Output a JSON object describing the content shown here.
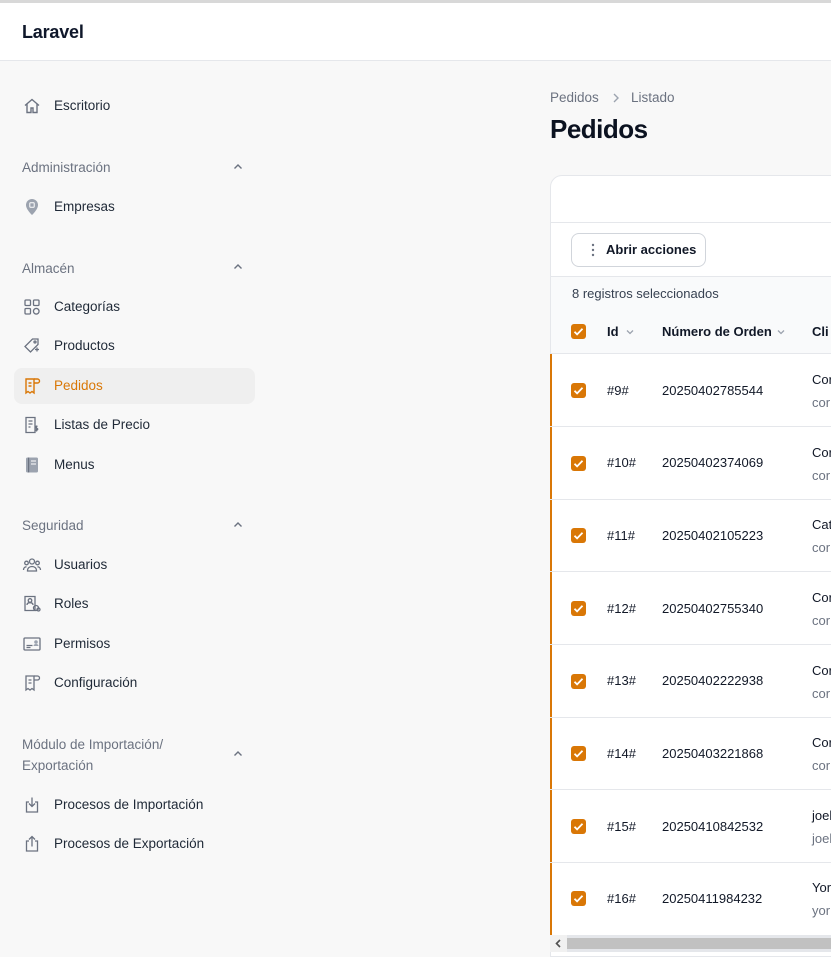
{
  "app": {
    "brand": "Laravel"
  },
  "sidebar": {
    "dashboard": "Escritorio",
    "groups": {
      "admin": {
        "label": "Administración",
        "items": [
          "Empresas"
        ]
      },
      "warehouse": {
        "label": "Almacén",
        "items": [
          "Categorías",
          "Productos",
          "Pedidos",
          "Listas de Precio",
          "Menus"
        ]
      },
      "security": {
        "label": "Seguridad",
        "items": [
          "Usuarios",
          "Roles",
          "Permisos",
          "Configuración"
        ]
      },
      "importexport": {
        "label_line1": "Módulo de Importación/",
        "label_line2": "Exportación",
        "items": [
          "Procesos de Importación",
          "Procesos de Exportación"
        ]
      }
    },
    "active_item": "Pedidos"
  },
  "breadcrumb": {
    "parent": "Pedidos",
    "current": "Listado"
  },
  "page": {
    "title": "Pedidos"
  },
  "table": {
    "actions_label": "Abrir acciones",
    "selected_text": "8 registros seleccionados",
    "columns": [
      "Id",
      "Número de Orden",
      "Cli"
    ],
    "rows": [
      {
        "id": "#9#",
        "order": "20250402785544",
        "client": "Cor",
        "client_sub": "cor"
      },
      {
        "id": "#10#",
        "order": "20250402374069",
        "client": "Cor",
        "client_sub": "cor"
      },
      {
        "id": "#11#",
        "order": "20250402105223",
        "client": "Cat",
        "client_sub": "cor"
      },
      {
        "id": "#12#",
        "order": "20250402755340",
        "client": "Cor",
        "client_sub": "cor"
      },
      {
        "id": "#13#",
        "order": "20250402222938",
        "client": "Cor",
        "client_sub": "cor"
      },
      {
        "id": "#14#",
        "order": "20250403221868",
        "client": "Cor",
        "client_sub": "cor"
      },
      {
        "id": "#15#",
        "order": "20250410842532",
        "client": "joel",
        "client_sub": "joel"
      },
      {
        "id": "#16#",
        "order": "20250411984232",
        "client": "Yor",
        "client_sub": "yor"
      }
    ]
  },
  "colors": {
    "accent": "#d97706",
    "text": "#111827",
    "muted": "#6b7280"
  }
}
